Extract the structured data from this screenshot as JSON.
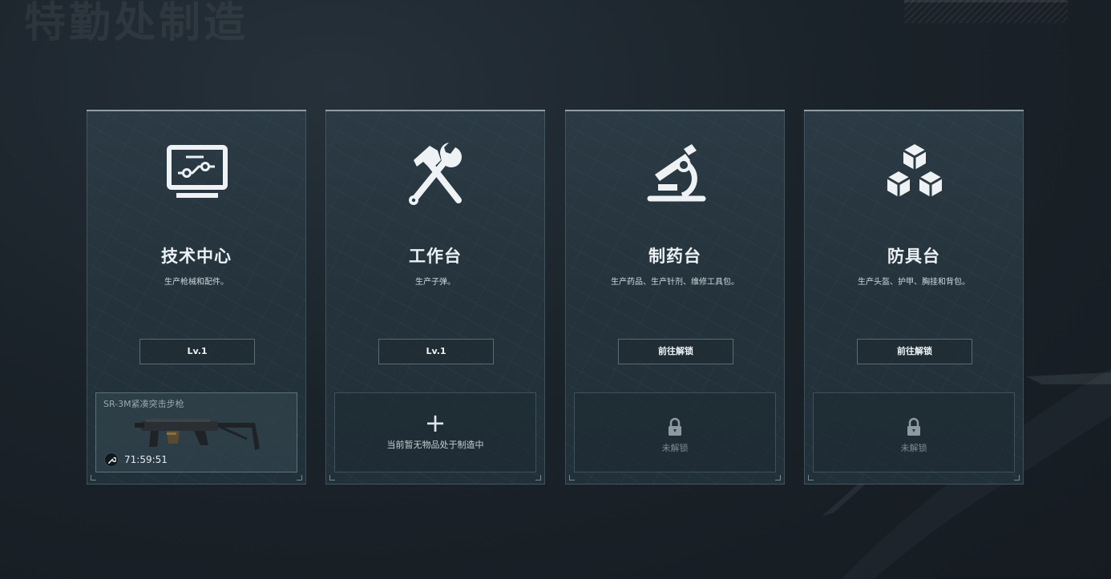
{
  "page_title": "特勤处制造",
  "workstations": [
    {
      "name": "技术中心",
      "icon": "monitor-circuit-icon",
      "description": "生产枪械和配件。",
      "button_label": "Lv.1",
      "slot": {
        "state": "crafting",
        "item_name": "SR-3M紧凑突击步枪",
        "item_icon": "rifle-icon",
        "timer_icon": "wrench-icon",
        "time_remaining": "71:59:51"
      }
    },
    {
      "name": "工作台",
      "icon": "hammer-wrench-icon",
      "description": "生产子弹。",
      "button_label": "Lv.1",
      "slot": {
        "state": "empty",
        "icon": "plus-icon",
        "text": "当前暂无物品处于制造中"
      }
    },
    {
      "name": "制药台",
      "icon": "microscope-icon",
      "description": "生产药品、生产针剂、维修工具包。",
      "button_label": "前往解锁",
      "slot": {
        "state": "locked",
        "icon": "lock-icon",
        "text": "未解锁"
      }
    },
    {
      "name": "防具台",
      "icon": "cubes-icon",
      "description": "生产头盔、护甲、胸挂和背包。",
      "button_label": "前往解锁",
      "slot": {
        "state": "locked",
        "icon": "lock-icon",
        "text": "未解锁"
      }
    }
  ],
  "colors": {
    "background": "#1b232a",
    "card": "#2b3a44",
    "text": "#ecf1f4",
    "muted": "#7f8b92"
  }
}
